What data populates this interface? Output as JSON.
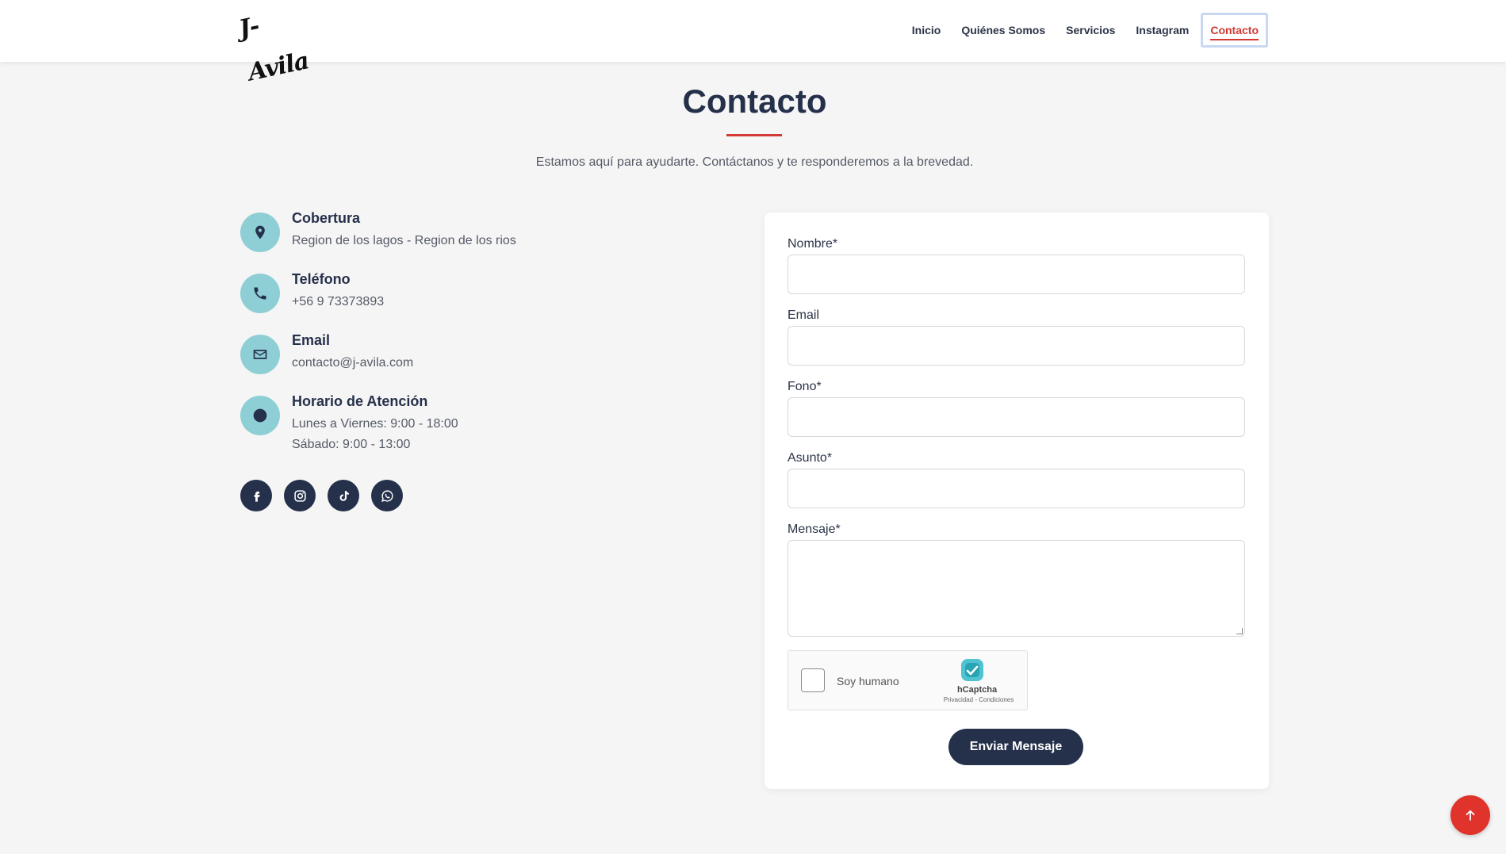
{
  "header": {
    "logo_text": "J-Avila",
    "nav": [
      {
        "label": "Inicio"
      },
      {
        "label": "Quiénes Somos"
      },
      {
        "label": "Servicios"
      },
      {
        "label": "Instagram"
      },
      {
        "label": "Contacto",
        "active": true
      }
    ]
  },
  "page": {
    "title": "Contacto",
    "subtitle": "Estamos aquí para ayudarte. Contáctanos y te responderemos a la brevedad."
  },
  "contact_info": [
    {
      "title": "Cobertura",
      "lines": [
        "Region de los lagos - Region de los rios"
      ],
      "icon": "location-pin-icon"
    },
    {
      "title": "Teléfono",
      "lines": [
        "+56 9 73373893"
      ],
      "icon": "phone-icon"
    },
    {
      "title": "Email",
      "lines": [
        "contacto@j-avila.com"
      ],
      "icon": "envelope-icon"
    },
    {
      "title": "Horario de Atención",
      "lines": [
        "Lunes a Viernes: 9:00 - 18:00",
        "Sábado: 9:00 - 13:00"
      ],
      "icon": "clock-icon"
    }
  ],
  "socials": [
    "facebook-icon",
    "instagram-icon",
    "tiktok-icon",
    "whatsapp-icon"
  ],
  "form": {
    "fields": [
      {
        "label": "Nombre*",
        "value": ""
      },
      {
        "label": "Email",
        "value": ""
      },
      {
        "label": "Fono*",
        "value": ""
      },
      {
        "label": "Asunto*",
        "value": ""
      },
      {
        "label": "Mensaje*",
        "value": ""
      }
    ],
    "captcha": {
      "label": "Soy humano",
      "brand": "hCaptcha",
      "links": "Privacidad - Condiciones"
    },
    "submit_label": "Enviar Mensaje"
  },
  "colors": {
    "accent_red": "#d23a33",
    "navy": "#25304a",
    "teal_icon_bg": "#8ecfd6",
    "background": "#f5f5f5"
  }
}
